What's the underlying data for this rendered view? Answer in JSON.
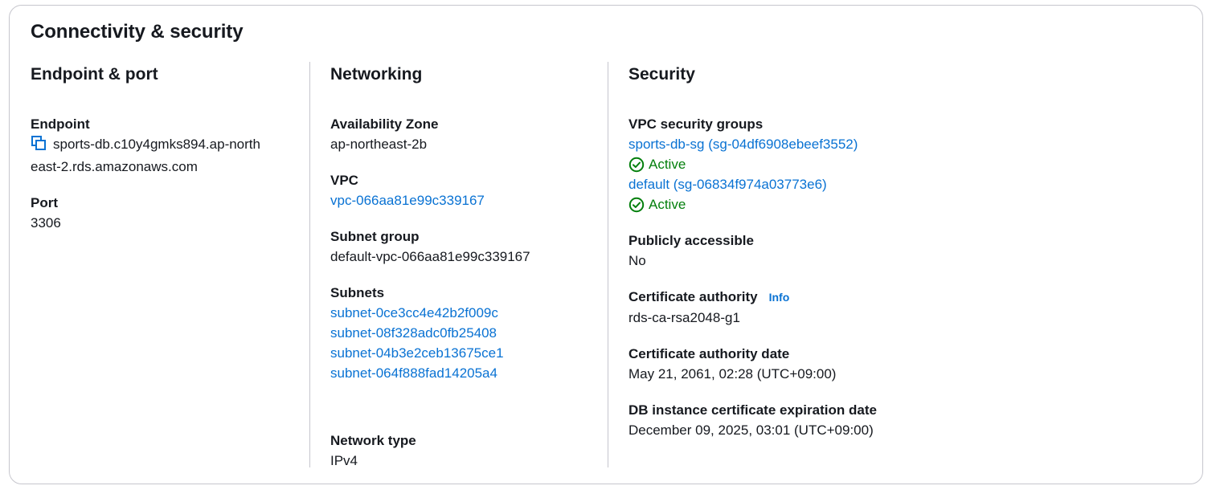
{
  "panel": {
    "title": "Connectivity & security"
  },
  "endpoint_port": {
    "title": "Endpoint & port",
    "endpoint_label": "Endpoint",
    "endpoint_line1": "sports-db.c10y4gmks894.ap-north",
    "endpoint_line2": "east-2.rds.amazonaws.com",
    "copy_icon": "copy-icon",
    "port_label": "Port",
    "port_value": "3306"
  },
  "networking": {
    "title": "Networking",
    "az_label": "Availability Zone",
    "az_value": "ap-northeast-2b",
    "vpc_label": "VPC",
    "vpc_value": "vpc-066aa81e99c339167",
    "subnet_group_label": "Subnet group",
    "subnet_group_value": "default-vpc-066aa81e99c339167",
    "subnets_label": "Subnets",
    "subnets": [
      "subnet-0ce3cc4e42b2f009c",
      "subnet-08f328adc0fb25408",
      "subnet-04b3e2ceb13675ce1",
      "subnet-064f888fad14205a4"
    ],
    "network_type_label": "Network type",
    "network_type_value": "IPv4"
  },
  "security": {
    "title": "Security",
    "sg_label": "VPC security groups",
    "security_groups": [
      {
        "name": "sports-db-sg (sg-04df6908ebeef3552)",
        "status": "Active"
      },
      {
        "name": "default (sg-06834f974a03773e6)",
        "status": "Active"
      }
    ],
    "status_icon": "check-circle-icon",
    "public_label": "Publicly accessible",
    "public_value": "No",
    "ca_label": "Certificate authority",
    "ca_info": "Info",
    "ca_value": "rds-ca-rsa2048-g1",
    "ca_date_label": "Certificate authority date",
    "ca_date_value": "May 21, 2061, 02:28 (UTC+09:00)",
    "expiry_label": "DB instance certificate expiration date",
    "expiry_value": "December 09, 2025, 03:01 (UTC+09:00)"
  },
  "colors": {
    "link": "#0972d3",
    "success": "#037f0c",
    "border": "#c6c6cd",
    "text": "#16191f"
  }
}
